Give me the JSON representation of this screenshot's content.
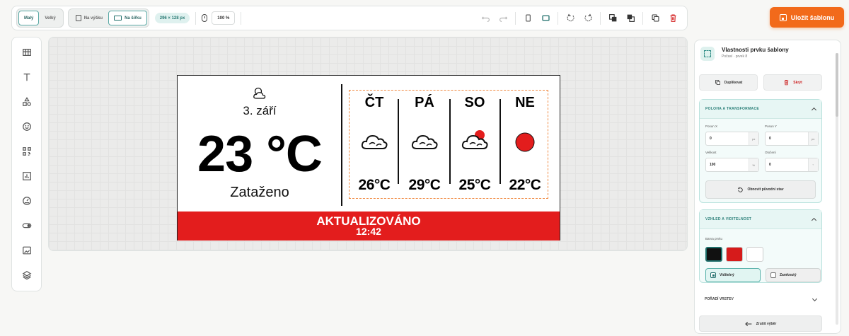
{
  "toolbar": {
    "size_small": "Malý",
    "size_large": "Velký",
    "orient_portrait": "Na výšku",
    "orient_landscape": "Na šířku",
    "resolution": "296 × 128 px",
    "zoom": "100 %"
  },
  "save_button": "Uložit šablonu",
  "display": {
    "date": "3. září",
    "temperature": "23 °C",
    "condition": "Zataženo",
    "forecast": [
      {
        "day": "ČT",
        "temp": "26°C",
        "icon": "cloud-icon"
      },
      {
        "day": "PÁ",
        "temp": "29°C",
        "icon": "cloud-icon"
      },
      {
        "day": "SO",
        "temp": "25°C",
        "icon": "cloud-sun-icon"
      },
      {
        "day": "NE",
        "temp": "22°C",
        "icon": "sun-icon"
      }
    ],
    "updated_label": "AKTUALIZOVÁNO",
    "updated_time": "12:42",
    "colors": {
      "red": "#e31d1d",
      "black": "#000000",
      "white": "#ffffff"
    }
  },
  "panel": {
    "title": "Vlastnosti prvku šablony",
    "subtitle": "Počasí · prvek 8",
    "duplicate": "Duplikovat",
    "hide": "Skrýt",
    "section_transform": "POLOHA A TRANSFORMACE",
    "pos_x_label": "Posun X",
    "pos_x_value": "0",
    "pos_y_label": "Posun Y",
    "pos_y_value": "0",
    "unit_px": "px",
    "size_label": "Velikost",
    "size_value": "100",
    "unit_pct": "%",
    "rotation_label": "Otočení",
    "rotation_value": "0",
    "unit_deg": "°",
    "reset": "Obnovit původní stav",
    "section_appearance": "VZHLED A VIDITELNOST",
    "color_label": "Barva prvku",
    "visible": "Viditelný",
    "locked": "Zamknutý",
    "layer_order": "POŘADÍ VRSTEV",
    "cancel_selection": "Zrušit výběr"
  },
  "accent_colors": {
    "brand_orange": "#f26a1b",
    "teal": "#2a7f78"
  }
}
